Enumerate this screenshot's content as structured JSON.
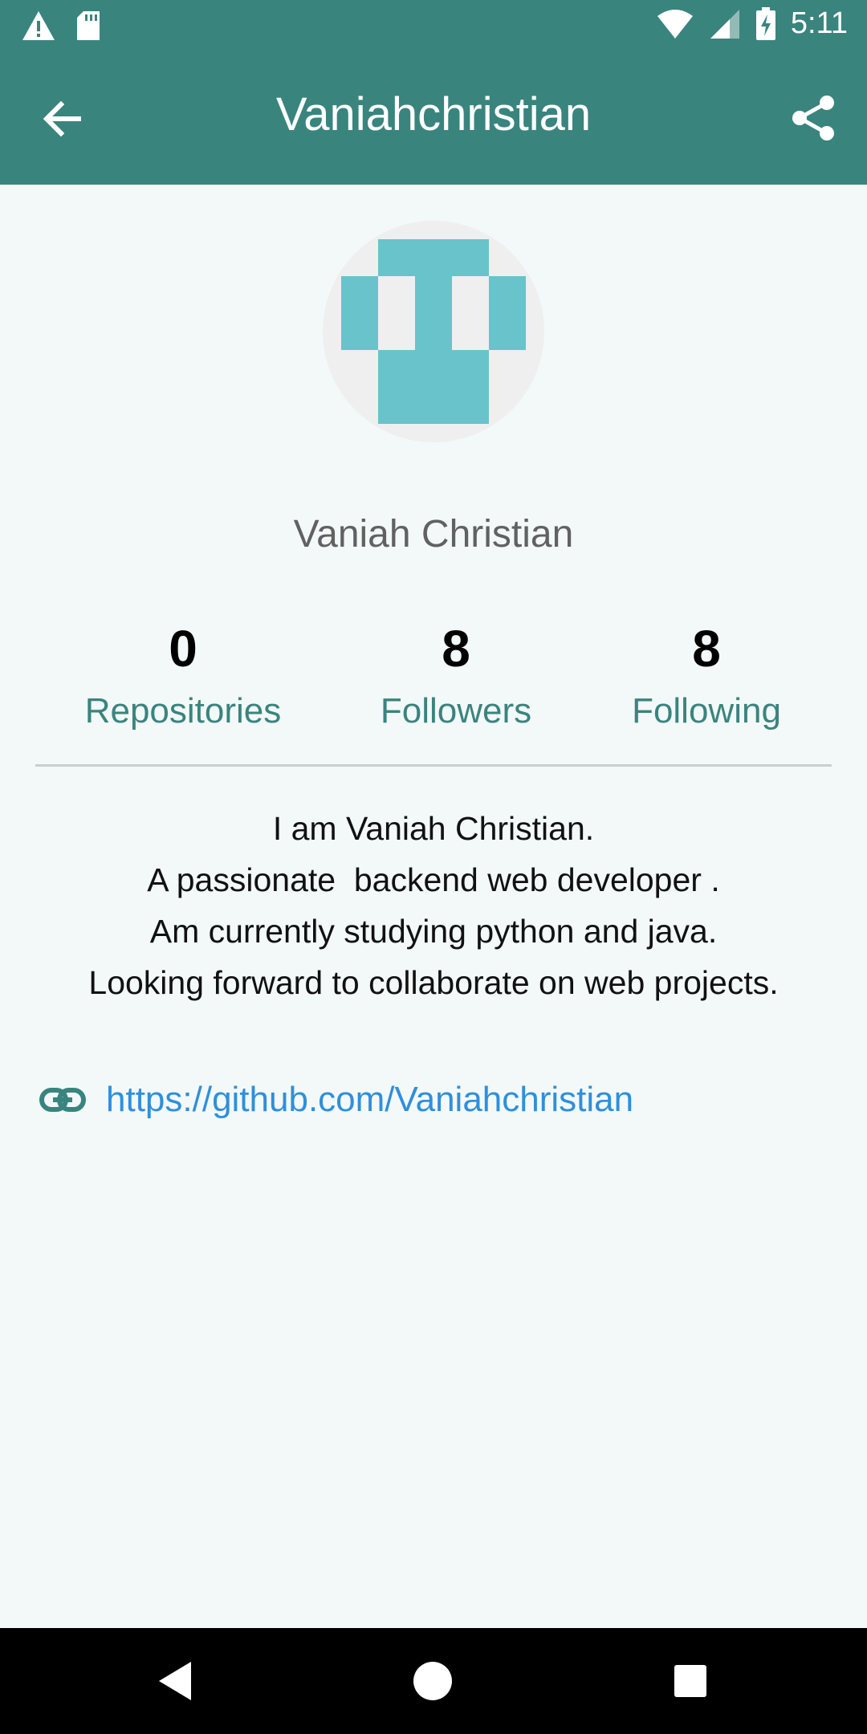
{
  "status_bar": {
    "time": "5:11",
    "icons": [
      "warning-icon",
      "sd-card-icon",
      "wifi-icon",
      "signal-icon",
      "battery-charging-icon"
    ]
  },
  "app_bar": {
    "title": "Vaniahchristian",
    "back_icon": "arrow-back-icon",
    "share_icon": "share-icon"
  },
  "profile": {
    "full_name": "Vaniah Christian",
    "stats": [
      {
        "value": "0",
        "label": "Repositories"
      },
      {
        "value": "8",
        "label": "Followers"
      },
      {
        "value": "8",
        "label": "Following"
      }
    ],
    "bio_lines": [
      "I am Vaniah Christian.",
      "A passionate  backend web developer .",
      "Am currently studying python and java.",
      "Looking forward to collaborate on web projects."
    ],
    "link": "https://github.com/Vaniahchristian"
  },
  "nav_bar": {
    "buttons": [
      "back-triangle-icon",
      "home-circle-icon",
      "recents-square-icon"
    ]
  },
  "colors": {
    "primary": "#3a847e",
    "avatar_pattern": "#69c3cb",
    "link": "#2f8fdc",
    "background": "#f3f9f8"
  }
}
